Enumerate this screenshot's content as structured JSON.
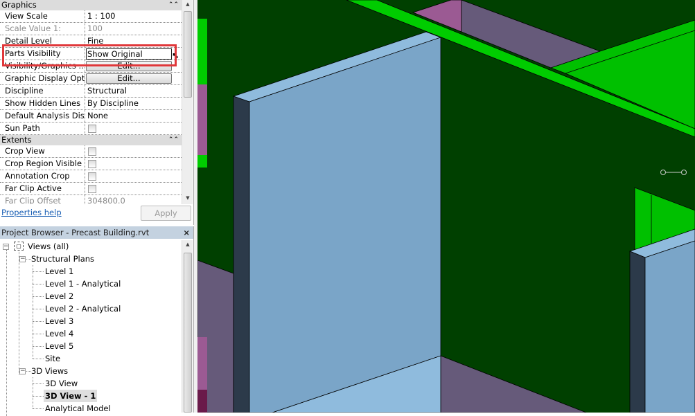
{
  "properties": {
    "sections": [
      {
        "title": "Graphics",
        "rows": [
          {
            "label": "View Scale",
            "value": "1 : 100"
          },
          {
            "label": "Scale Value    1:",
            "value": "100",
            "disabled": true
          },
          {
            "label": "Detail Level",
            "value": "Fine"
          },
          {
            "label": "Parts Visibility",
            "value": "Show Original",
            "highlighted": true
          },
          {
            "label": "Visibility/Graphics ...",
            "value": "Edit...",
            "button": true
          },
          {
            "label": "Graphic Display Opt...",
            "value": "Edit...",
            "button": true
          },
          {
            "label": "Discipline",
            "value": "Structural"
          },
          {
            "label": "Show Hidden Lines",
            "value": "By Discipline"
          },
          {
            "label": "Default Analysis Dis...",
            "value": "None"
          },
          {
            "label": "Sun Path",
            "checkbox": false
          }
        ]
      },
      {
        "title": "Extents",
        "rows": [
          {
            "label": "Crop View",
            "checkbox": false
          },
          {
            "label": "Crop Region Visible",
            "checkbox": false
          },
          {
            "label": "Annotation Crop",
            "checkbox": false
          },
          {
            "label": "Far Clip Active",
            "checkbox": false
          },
          {
            "label": "Far Clip Offset",
            "value": "304800.0",
            "disabled": true
          }
        ]
      }
    ],
    "help_link": "Properties help",
    "apply_label": "Apply"
  },
  "browser": {
    "title": "Project Browser - Precast Building.rvt",
    "close": "×",
    "root": "Views (all)",
    "groups": [
      {
        "label": "Structural Plans",
        "items": [
          "Level 1",
          "Level 1 - Analytical",
          "Level 2",
          "Level 2 - Analytical",
          "Level 3",
          "Level 4",
          "Level 5",
          "Site"
        ]
      },
      {
        "label": "3D Views",
        "items": [
          "3D View",
          "3D View - 1",
          "Analytical Model"
        ],
        "selected": "3D View - 1"
      }
    ]
  },
  "colors": {
    "highlight": "#e0373a",
    "background_green": "#004000",
    "wall": "#7aa5c8"
  }
}
